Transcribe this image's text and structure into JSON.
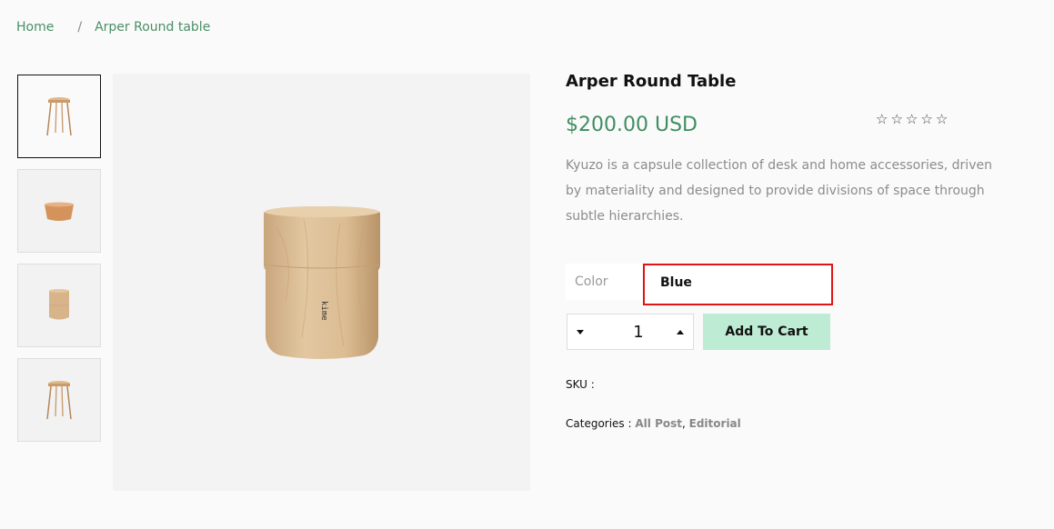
{
  "breadcrumb": {
    "home": "Home",
    "separator": "/",
    "current": "Arper Round table"
  },
  "product": {
    "title": "Arper Round Table",
    "price": "$200.00 USD",
    "rating_stars": 5,
    "rating_value": 0,
    "description": "Kyuzo is a capsule collection of desk and home accessories, driven by materiality and designed to provide divisions of space through subtle hierarchies."
  },
  "options": {
    "color_label": "Color",
    "color_value": "Blue"
  },
  "quantity": {
    "value": "1"
  },
  "add_to_cart_label": "Add To Cart",
  "sku_label": "SKU :",
  "categories": {
    "label": "Categories :",
    "items": [
      "All Post",
      "Editorial"
    ],
    "separator": ","
  },
  "colors": {
    "accent_green": "#3f8e63",
    "cart_button_bg": "#bdebd3",
    "highlight_border": "#e01515"
  },
  "thumbnails": [
    "stool",
    "bowl",
    "cup",
    "stool"
  ]
}
